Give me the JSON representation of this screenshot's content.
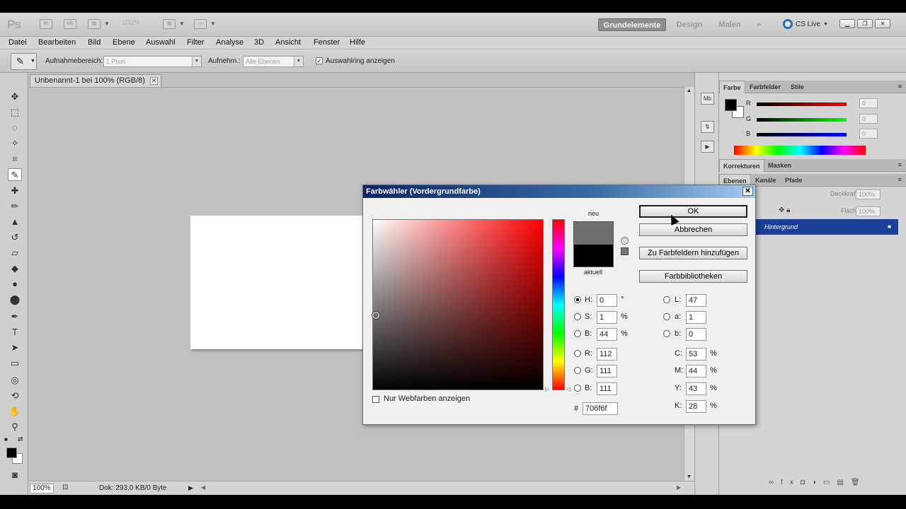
{
  "appbar": {
    "logo": "Ps",
    "zoom": "100%",
    "workspaces": [
      "Grundelemente",
      "Design",
      "Malen",
      "»"
    ],
    "cs_live": "CS Live"
  },
  "menu": [
    "Datei",
    "Bearbeiten",
    "Bild",
    "Ebene",
    "Auswahl",
    "Filter",
    "Analyse",
    "3D",
    "Ansicht",
    "Fenster",
    "Hilfe"
  ],
  "options": {
    "sample_size_label": "Aufnahmebereich:",
    "sample_size_value": "1 Pixel",
    "sample_label": "Aufnehm.:",
    "sample_value": "Alle Ebenen",
    "show_ring_label": "Auswahlring anzeigen",
    "show_ring_checked": true
  },
  "document": {
    "tab_title": "Unbenannt-1 bei 100% (RGB/8)",
    "status_zoom": "100%",
    "status_info": "Dok: 293,0 KB/0 Byte"
  },
  "color_panel": {
    "tabs": [
      "Farbe",
      "Farbfelder",
      "Stile"
    ],
    "channels": [
      {
        "name": "R",
        "value": "0"
      },
      {
        "name": "G",
        "value": "0"
      },
      {
        "name": "B",
        "value": "0"
      }
    ]
  },
  "adjust_panel": {
    "tabs": [
      "Korrekturen",
      "Masken"
    ]
  },
  "layers_panel": {
    "tabs": [
      "Ebenen",
      "Kanäle",
      "Pfade"
    ],
    "opacity_label": "Deckkraft:",
    "opacity_value": "100%",
    "fill_label": "Fläche:",
    "fill_value": "100%",
    "layer_name": "Hintergrund"
  },
  "dialog": {
    "title": "Farbwähler (Vordergrundfarbe)",
    "label_new": "neu",
    "label_current": "aktuell",
    "new_color": "#706f6f",
    "current_color": "#000000",
    "buttons": {
      "ok": "OK",
      "cancel": "Abbrechen",
      "add_swatches": "Zu Farbfeldern hinzufügen",
      "libraries": "Farbbibliotheken"
    },
    "hsb": [
      {
        "label": "H:",
        "value": "0",
        "unit": "°",
        "selected": true
      },
      {
        "label": "S:",
        "value": "1",
        "unit": "%",
        "selected": false
      },
      {
        "label": "B:",
        "value": "44",
        "unit": "%",
        "selected": false
      }
    ],
    "rgb": [
      {
        "label": "R:",
        "value": "112"
      },
      {
        "label": "G:",
        "value": "111"
      },
      {
        "label": "B:",
        "value": "111"
      }
    ],
    "lab": [
      {
        "label": "L:",
        "value": "47"
      },
      {
        "label": "a:",
        "value": "1"
      },
      {
        "label": "b:",
        "value": "0"
      }
    ],
    "cmyk": [
      {
        "label": "C:",
        "value": "53",
        "unit": "%"
      },
      {
        "label": "M:",
        "value": "44",
        "unit": "%"
      },
      {
        "label": "Y:",
        "value": "43",
        "unit": "%"
      },
      {
        "label": "K:",
        "value": "28",
        "unit": "%"
      }
    ],
    "hex_label": "#",
    "hex_value": "706f6f",
    "web_only_label": "Nur Webfarben anzeigen",
    "web_only_checked": false
  }
}
